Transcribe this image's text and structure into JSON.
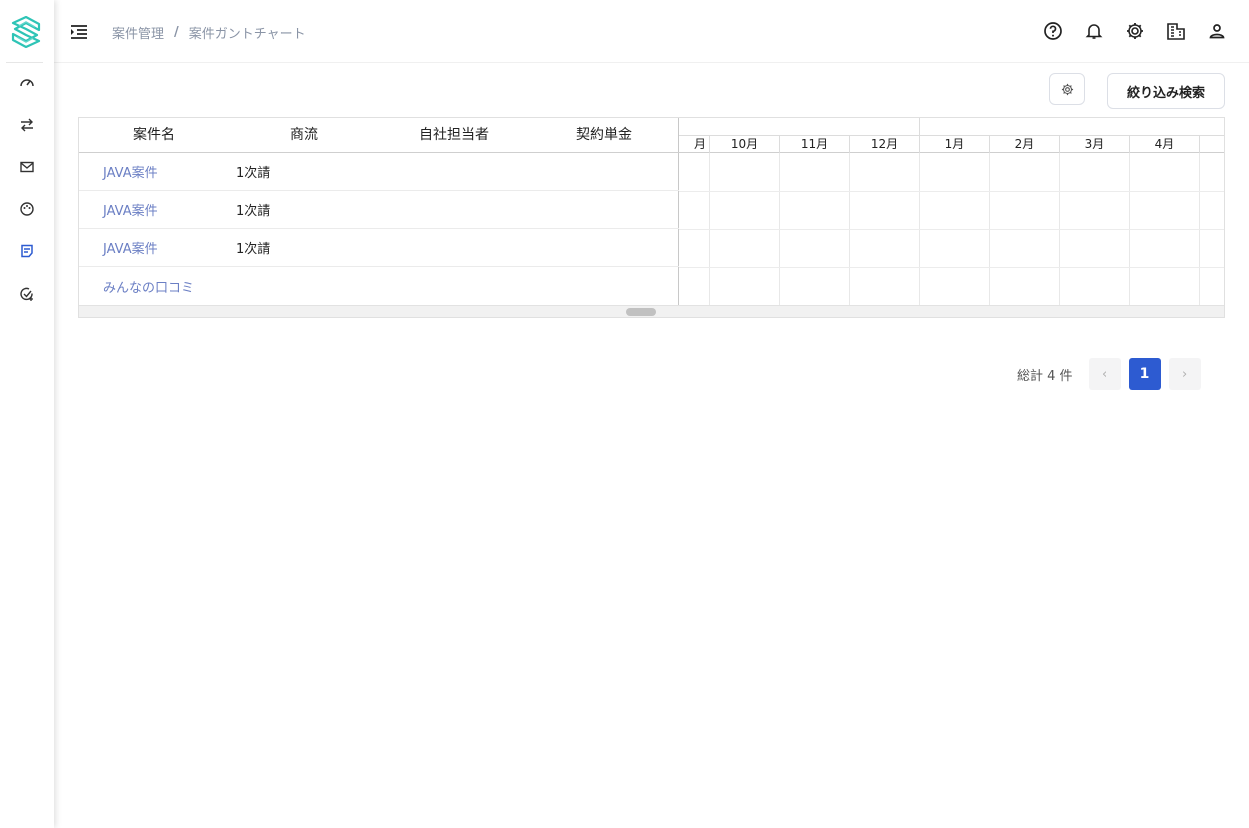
{
  "header": {
    "breadcrumb": [
      "案件管理",
      "案件ガントチャート"
    ],
    "separator": "/"
  },
  "toolbar": {
    "filter_label": "絞り込み検索"
  },
  "table": {
    "columns": [
      "案件名",
      "商流",
      "自社担当者",
      "契約単金"
    ],
    "rows": [
      {
        "name": "JAVA案件",
        "flow": "1次請",
        "owner": "",
        "price": ""
      },
      {
        "name": "JAVA案件",
        "flow": "1次請",
        "owner": "",
        "price": ""
      },
      {
        "name": "JAVA案件",
        "flow": "1次請",
        "owner": "",
        "price": ""
      },
      {
        "name": "みんなの口コミ",
        "flow": "",
        "owner": "",
        "price": ""
      }
    ]
  },
  "gantt": {
    "partial_month": "月",
    "months": [
      "10月",
      "11月",
      "12月",
      "1月",
      "2月",
      "3月",
      "4月"
    ]
  },
  "pagination": {
    "total_label": "総計 4 件",
    "current_page": "1",
    "prev": "‹",
    "next": "›"
  },
  "colors": {
    "accent": "#2d5bd1",
    "link": "#6b7fc4",
    "logo": "#2ec4b6"
  },
  "icons": {
    "sidebar": [
      "dashboard-icon",
      "transfer-icon",
      "mail-icon",
      "palette-icon",
      "document-icon",
      "check-add-icon"
    ],
    "header": [
      "help-icon",
      "bell-icon",
      "gear-icon",
      "building-icon",
      "user-icon"
    ]
  }
}
